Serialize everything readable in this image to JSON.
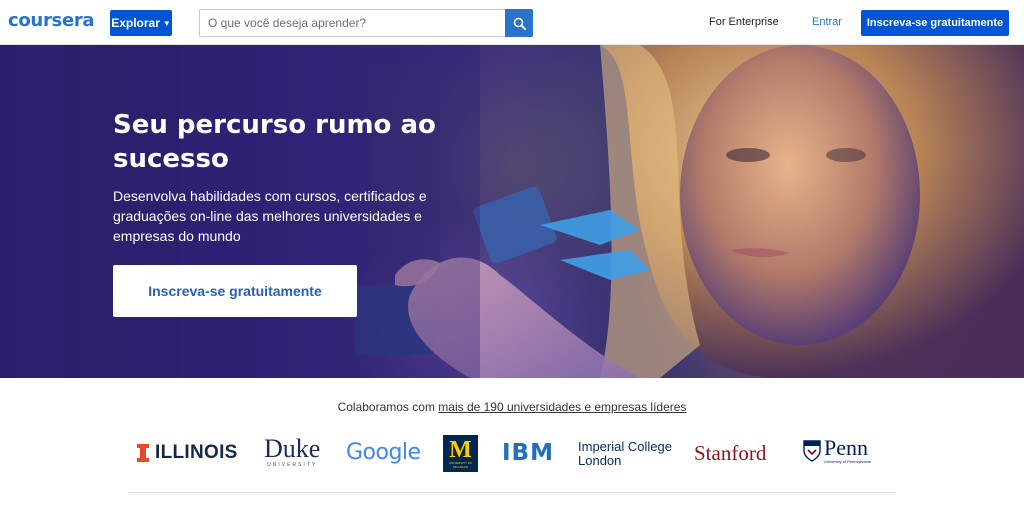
{
  "header": {
    "logo": "coursera",
    "explore_label": "Explorar",
    "search_placeholder": "O que você deseja aprender?",
    "enterprise_label": "For Enterprise",
    "login_label": "Entrar",
    "signup_label": "Inscreva-se gratuitamente"
  },
  "hero": {
    "title": "Seu percurso rumo ao sucesso",
    "subtitle": "Desenvolva habilidades com cursos, certificados e graduações on-line das melhores universidades e empresas do mundo",
    "cta_label": "Inscreva-se gratuitamente"
  },
  "partners": {
    "prefix": "Colaboramos com ",
    "link_text": "mais de 190 universidades e empresas líderes",
    "logos": {
      "illinois": "ILLINOIS",
      "duke": "Duke",
      "duke_sub": "UNIVERSITY",
      "google": "Google",
      "michigan": "M",
      "michigan_sub": "UNIVERSITY OF MICHIGAN",
      "ibm": "IBM",
      "imperial_1": "Imperial College",
      "imperial_2": "London",
      "stanford": "Stanford",
      "penn": "Penn",
      "penn_sub": "University of Pennsylvania"
    }
  },
  "colors": {
    "brand_blue": "#0056d2",
    "link_blue": "#2a73cc",
    "hero_purple": "#33247a",
    "stanford_red": "#8c1515",
    "illinois_orange": "#e84a27",
    "michigan_blue": "#00274c",
    "michigan_maize": "#ffcb05",
    "ibm_blue": "#1f70c1"
  }
}
